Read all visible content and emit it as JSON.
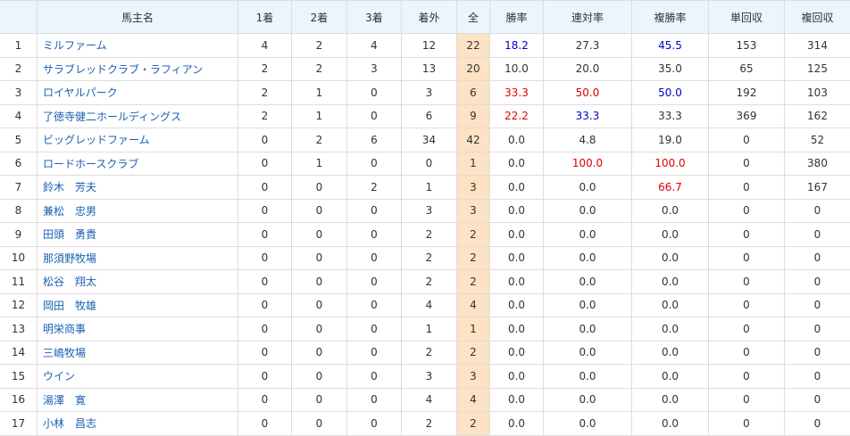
{
  "headers": [
    "",
    "馬主名",
    "1着",
    "2着",
    "3着",
    "着外",
    "全",
    "勝率",
    "連対率",
    "複勝率",
    "単回収",
    "複回収"
  ],
  "rows": [
    {
      "rank": "1",
      "name": "ミルファーム",
      "w1": "4",
      "w2": "2",
      "w3": "4",
      "out": "12",
      "total": "22",
      "win": "18.2",
      "place": "27.3",
      "show": "45.5",
      "tan": "153",
      "fuku": "314",
      "win_color": "blue",
      "place_color": "",
      "show_color": "blue"
    },
    {
      "rank": "2",
      "name": "サラブレッドクラブ・ラフィアン",
      "w1": "2",
      "w2": "2",
      "w3": "3",
      "out": "13",
      "total": "20",
      "win": "10.0",
      "place": "20.0",
      "show": "35.0",
      "tan": "65",
      "fuku": "125",
      "win_color": "",
      "place_color": "",
      "show_color": ""
    },
    {
      "rank": "3",
      "name": "ロイヤルパーク",
      "w1": "2",
      "w2": "1",
      "w3": "0",
      "out": "3",
      "total": "6",
      "win": "33.3",
      "place": "50.0",
      "show": "50.0",
      "tan": "192",
      "fuku": "103",
      "win_color": "red",
      "place_color": "red",
      "show_color": "blue"
    },
    {
      "rank": "4",
      "name": "了徳寺健二ホールディングス",
      "w1": "2",
      "w2": "1",
      "w3": "0",
      "out": "6",
      "total": "9",
      "win": "22.2",
      "place": "33.3",
      "show": "33.3",
      "tan": "369",
      "fuku": "162",
      "win_color": "red",
      "place_color": "blue",
      "show_color": ""
    },
    {
      "rank": "5",
      "name": "ビッグレッドファーム",
      "w1": "0",
      "w2": "2",
      "w3": "6",
      "out": "34",
      "total": "42",
      "win": "0.0",
      "place": "4.8",
      "show": "19.0",
      "tan": "0",
      "fuku": "52",
      "win_color": "",
      "place_color": "",
      "show_color": ""
    },
    {
      "rank": "6",
      "name": "ロードホースクラブ",
      "w1": "0",
      "w2": "1",
      "w3": "0",
      "out": "0",
      "total": "1",
      "win": "0.0",
      "place": "100.0",
      "show": "100.0",
      "tan": "0",
      "fuku": "380",
      "win_color": "",
      "place_color": "red",
      "show_color": "red"
    },
    {
      "rank": "7",
      "name": "鈴木　芳夫",
      "w1": "0",
      "w2": "0",
      "w3": "2",
      "out": "1",
      "total": "3",
      "win": "0.0",
      "place": "0.0",
      "show": "66.7",
      "tan": "0",
      "fuku": "167",
      "win_color": "",
      "place_color": "",
      "show_color": "red"
    },
    {
      "rank": "8",
      "name": "兼松　忠男",
      "w1": "0",
      "w2": "0",
      "w3": "0",
      "out": "3",
      "total": "3",
      "win": "0.0",
      "place": "0.0",
      "show": "0.0",
      "tan": "0",
      "fuku": "0",
      "win_color": "",
      "place_color": "",
      "show_color": ""
    },
    {
      "rank": "9",
      "name": "田頭　勇貴",
      "w1": "0",
      "w2": "0",
      "w3": "0",
      "out": "2",
      "total": "2",
      "win": "0.0",
      "place": "0.0",
      "show": "0.0",
      "tan": "0",
      "fuku": "0",
      "win_color": "",
      "place_color": "",
      "show_color": ""
    },
    {
      "rank": "10",
      "name": "那須野牧場",
      "w1": "0",
      "w2": "0",
      "w3": "0",
      "out": "2",
      "total": "2",
      "win": "0.0",
      "place": "0.0",
      "show": "0.0",
      "tan": "0",
      "fuku": "0",
      "win_color": "",
      "place_color": "",
      "show_color": ""
    },
    {
      "rank": "11",
      "name": "松谷　翔太",
      "w1": "0",
      "w2": "0",
      "w3": "0",
      "out": "2",
      "total": "2",
      "win": "0.0",
      "place": "0.0",
      "show": "0.0",
      "tan": "0",
      "fuku": "0",
      "win_color": "",
      "place_color": "",
      "show_color": ""
    },
    {
      "rank": "12",
      "name": "岡田　牧雄",
      "w1": "0",
      "w2": "0",
      "w3": "0",
      "out": "4",
      "total": "4",
      "win": "0.0",
      "place": "0.0",
      "show": "0.0",
      "tan": "0",
      "fuku": "0",
      "win_color": "",
      "place_color": "",
      "show_color": ""
    },
    {
      "rank": "13",
      "name": "明栄商事",
      "w1": "0",
      "w2": "0",
      "w3": "0",
      "out": "1",
      "total": "1",
      "win": "0.0",
      "place": "0.0",
      "show": "0.0",
      "tan": "0",
      "fuku": "0",
      "win_color": "",
      "place_color": "",
      "show_color": ""
    },
    {
      "rank": "14",
      "name": "三嶋牧場",
      "w1": "0",
      "w2": "0",
      "w3": "0",
      "out": "2",
      "total": "2",
      "win": "0.0",
      "place": "0.0",
      "show": "0.0",
      "tan": "0",
      "fuku": "0",
      "win_color": "",
      "place_color": "",
      "show_color": ""
    },
    {
      "rank": "15",
      "name": "ウイン",
      "w1": "0",
      "w2": "0",
      "w3": "0",
      "out": "3",
      "total": "3",
      "win": "0.0",
      "place": "0.0",
      "show": "0.0",
      "tan": "0",
      "fuku": "0",
      "win_color": "",
      "place_color": "",
      "show_color": ""
    },
    {
      "rank": "16",
      "name": "湯澤　寛",
      "w1": "0",
      "w2": "0",
      "w3": "0",
      "out": "4",
      "total": "4",
      "win": "0.0",
      "place": "0.0",
      "show": "0.0",
      "tan": "0",
      "fuku": "0",
      "win_color": "",
      "place_color": "",
      "show_color": ""
    },
    {
      "rank": "17",
      "name": "小林　昌志",
      "w1": "0",
      "w2": "0",
      "w3": "0",
      "out": "2",
      "total": "2",
      "win": "0.0",
      "place": "0.0",
      "show": "0.0",
      "tan": "0",
      "fuku": "0",
      "win_color": "",
      "place_color": "",
      "show_color": ""
    }
  ],
  "colors": {
    "link": "#1a5fb4",
    "header_bg": "#eaf5fc",
    "total_bg": "#fde2c4",
    "red": "#e00000",
    "blue": "#0000cc",
    "border": "#dddddd"
  }
}
